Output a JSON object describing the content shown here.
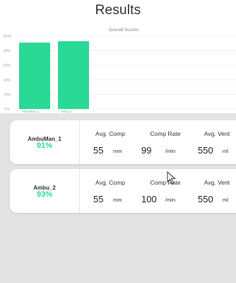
{
  "page": {
    "title": "Results"
  },
  "chart_data": {
    "type": "bar",
    "title": "Overall Scores",
    "categories": [
      "AmbuMan_1",
      "Ambu_2"
    ],
    "values": [
      91,
      93
    ],
    "ylim": [
      0,
      100
    ],
    "yticks": [
      "0%",
      "20%",
      "40%",
      "60%",
      "80%",
      "100%"
    ],
    "grid": true,
    "bar_color": "#2bd996"
  },
  "results": [
    {
      "name": "AmbuMan_1",
      "score": "91%",
      "metrics": [
        {
          "label": "Avg. Comp",
          "value": "55",
          "unit": "mm"
        },
        {
          "label": "Comp Rate",
          "value": "99",
          "unit": "/min"
        },
        {
          "label": "Avg. Vent",
          "value": "550",
          "unit": "ml"
        }
      ]
    },
    {
      "name": "Ambu_2",
      "score": "93%",
      "metrics": [
        {
          "label": "Avg. Comp",
          "value": "55",
          "unit": "mm"
        },
        {
          "label": "Comp Rate",
          "value": "100",
          "unit": "/min"
        },
        {
          "label": "Avg. Vent",
          "value": "550",
          "unit": "ml"
        }
      ]
    }
  ],
  "colors": {
    "accent": "#2bd996",
    "panel_bg": "#e3e3e3"
  },
  "icons": {
    "cursor": "mouse-pointer-icon"
  }
}
